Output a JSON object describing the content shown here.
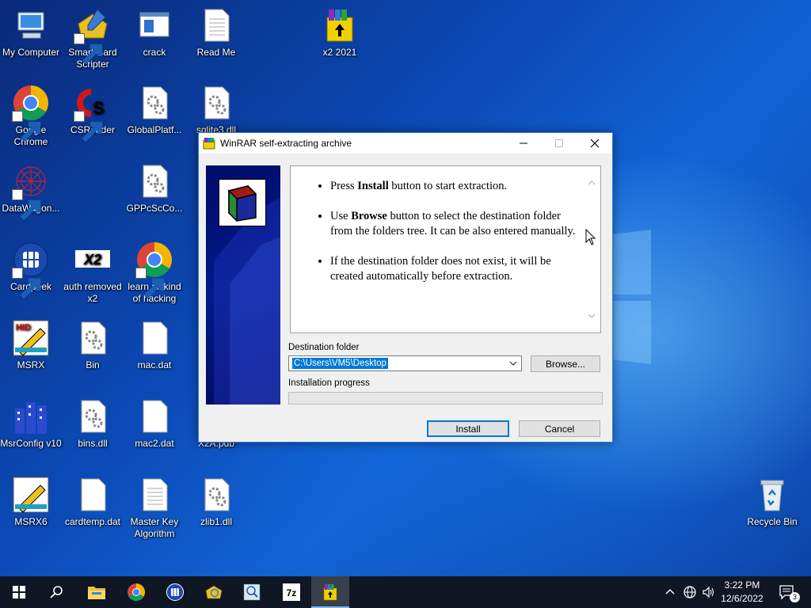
{
  "desktop": {
    "icons": [
      {
        "label": "My Computer"
      },
      {
        "label": "Smart Card Scripter"
      },
      {
        "label": "crack"
      },
      {
        "label": "Read Me"
      },
      {
        "label": "x2 2021"
      },
      {
        "label": "Google Chrome"
      },
      {
        "label": "CSReader"
      },
      {
        "label": "GlobalPlatf..."
      },
      {
        "label": "sqlite3.dll"
      },
      {
        "label": "DataWagon..."
      },
      {
        "label": "GPPcScCo..."
      },
      {
        "label": "Cardpeek"
      },
      {
        "label": "auth removed x2"
      },
      {
        "label": "learn all kind of hacking"
      },
      {
        "label": "MSRX"
      },
      {
        "label": "Bin"
      },
      {
        "label": "mac.dat"
      },
      {
        "label": "MsrConfig v10"
      },
      {
        "label": "bins.dll"
      },
      {
        "label": "mac2.dat"
      },
      {
        "label": "X2A.pdb"
      },
      {
        "label": "MSRX6"
      },
      {
        "label": "cardtemp.dat"
      },
      {
        "label": "Master Key Algorithm"
      },
      {
        "label": "zlib1.dll"
      },
      {
        "label": "Recycle Bin"
      }
    ]
  },
  "dialog": {
    "title": "WinRAR self-extracting archive",
    "bullets": [
      {
        "pre": "Press ",
        "bold": "Install",
        "post": " button to start extraction."
      },
      {
        "pre": "Use ",
        "bold": "Browse",
        "post": " button to select the destination folder from the folders tree. It can be also entered manually."
      },
      {
        "pre": "",
        "bold": "",
        "post": "If the destination folder does not exist, it will be created automatically before extraction."
      }
    ],
    "destination_label": "Destination folder",
    "destination_value": "C:\\Users\\VM5\\Desktop",
    "browse_label": "Browse...",
    "progress_label": "Installation progress",
    "progress": 0,
    "install_label": "Install",
    "cancel_label": "Cancel"
  },
  "taskbar": {
    "time": "3:22 PM",
    "date": "12/6/2022",
    "notification_count": "3",
    "apps": [
      "start-icon",
      "search-icon",
      "file-explorer-icon",
      "chrome-icon",
      "cardpeek-icon",
      "smart-card-icon",
      "magnifier-icon",
      "7zip-icon",
      "winrar-icon"
    ],
    "seven_zip_label": "7z"
  }
}
